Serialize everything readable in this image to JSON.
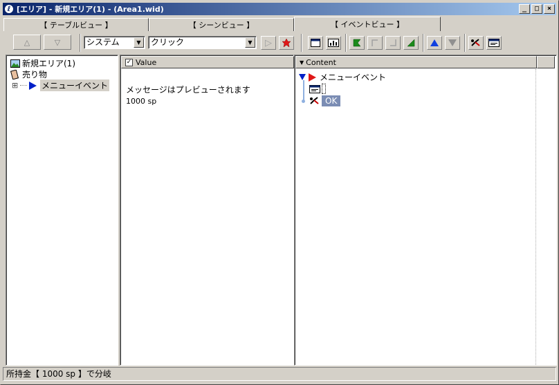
{
  "window": {
    "title": "[エリア] - 新規エリア(1) - (Area1.wid)",
    "controls": {
      "minimize": "_",
      "maximize": "□",
      "close": "×"
    }
  },
  "tabs": [
    {
      "label": "【 テーブルビュー 】",
      "active": false
    },
    {
      "label": "【 シーンビュー 】",
      "active": false
    },
    {
      "label": "【 イベントビュー 】",
      "active": true
    }
  ],
  "toolbar": {
    "up_label": "△",
    "down_label": "▽",
    "category_combo": {
      "value": "システム"
    },
    "event_combo": {
      "value": "クリック"
    },
    "play_label": "▷"
  },
  "tree": {
    "root": {
      "label": "新規エリア(1)",
      "icon": "landscape-icon"
    },
    "items": [
      {
        "label": "売り物",
        "icon": "book-icon"
      },
      {
        "label": "メニューイベント",
        "icon": "blue-triangle-icon",
        "expander": "⊞",
        "selected": true
      }
    ]
  },
  "value_panel": {
    "column_header": "Value",
    "checkbox_mark": "✓",
    "lines": [
      "メッセージはプレビューされます",
      "1000 sp"
    ]
  },
  "content_panel": {
    "column_header": "Content",
    "sort_mark": "▼",
    "nodes": [
      {
        "label": "メニューイベント",
        "icon": "red-flag-icon"
      },
      {
        "label": "",
        "icon": "message-window-icon"
      },
      {
        "label": "OK",
        "icon": "branch-icon",
        "selected": true
      }
    ]
  },
  "statusbar": {
    "text": "所持金【 1000 sp 】で分岐"
  },
  "colors": {
    "titlebar_start": "#0a246a",
    "titlebar_end": "#a6caf0",
    "face": "#d4d0c8",
    "selection": "#7b8db4"
  }
}
